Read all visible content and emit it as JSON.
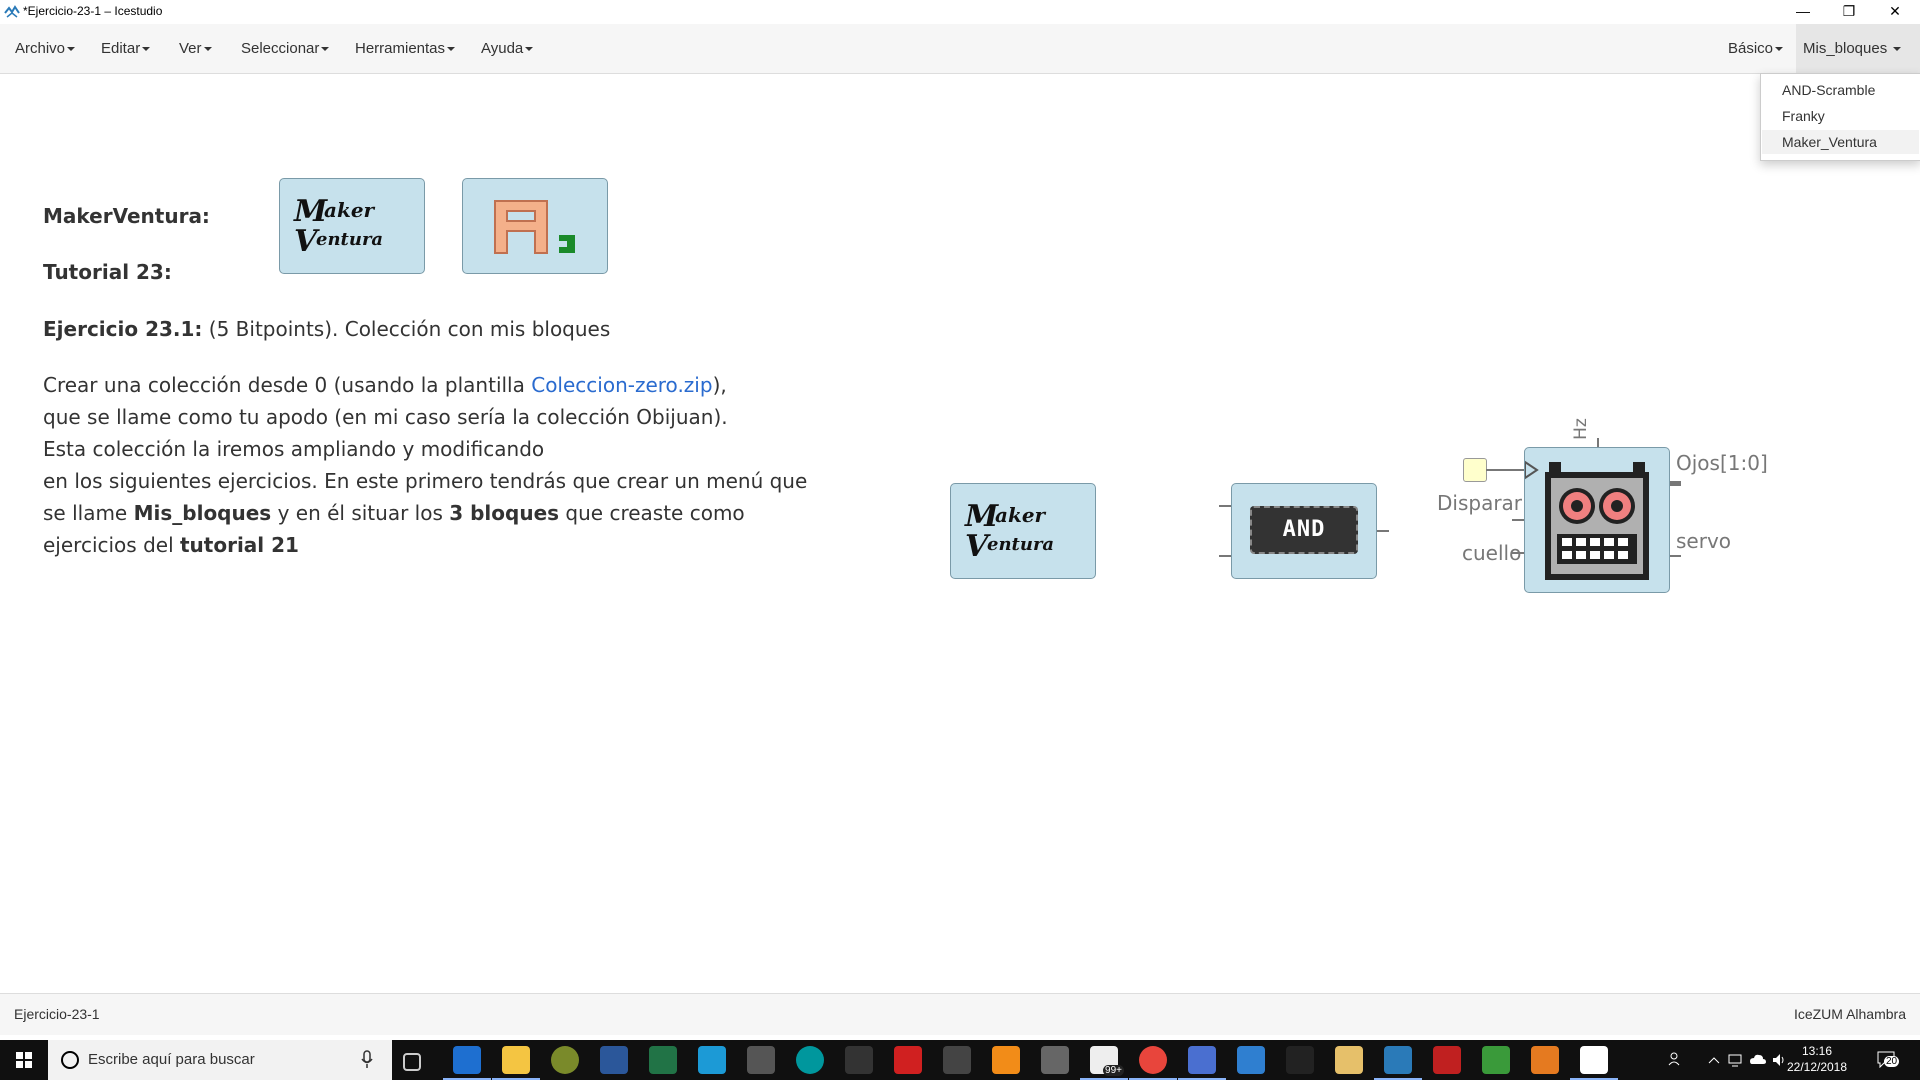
{
  "window": {
    "title": "*Ejercicio-23-1 – Icestudio",
    "min": "—",
    "max": "❐",
    "close": "✕"
  },
  "menubar": {
    "left": [
      "Archivo",
      "Editar",
      "Ver",
      "Seleccionar",
      "Herramientas",
      "Ayuda"
    ],
    "right": [
      "Básico",
      "Mis_bloques"
    ]
  },
  "dropdown": {
    "items": [
      "AND-Scramble",
      "Franky",
      "Maker_Ventura"
    ]
  },
  "note": {
    "makerventura_label": "MakerVentura:",
    "tutorial_label": "Tutorial 23:",
    "exercise_bold": "Ejercicio 23.1:",
    "exercise_rest": " (5 Bitpoints). Colección con mis bloques",
    "p1_a": "Crear una colección desde 0 (usando la plantilla ",
    "p1_link": "Coleccion-zero.zip",
    "p1_b": "),",
    "p2": "que se llame como tu apodo (en mi caso sería la colección Obijuan).",
    "p3": "Esta colección la iremos ampliando y modificando",
    "p4": "en los siguientes ejercicios. En este primero tendrás que crear un menú que",
    "p5_a": "se llame ",
    "p5_b": "Mis_bloques",
    "p5_c": " y en él situar los ",
    "p5_d": "3 bloques",
    "p5_e": " que creaste como",
    "p6_a": "ejercicios del ",
    "p6_b": "tutorial 21"
  },
  "blocks": {
    "and_label": "AND",
    "maker_logo_text": "Maker Ventura",
    "robot_ports": {
      "hz": "Hz",
      "disparar": "Disparar",
      "cuello": "cuello",
      "ojos": "Ojos[1:0]",
      "servo": "servo"
    }
  },
  "statusbar": {
    "left": "Ejercicio-23-1",
    "right": "IceZUM Alhambra"
  },
  "taskbar": {
    "search_placeholder": "Escribe aquí para buscar",
    "time": "13:16",
    "date": "22/12/2018",
    "notif_count": "20",
    "badge": "99+"
  }
}
